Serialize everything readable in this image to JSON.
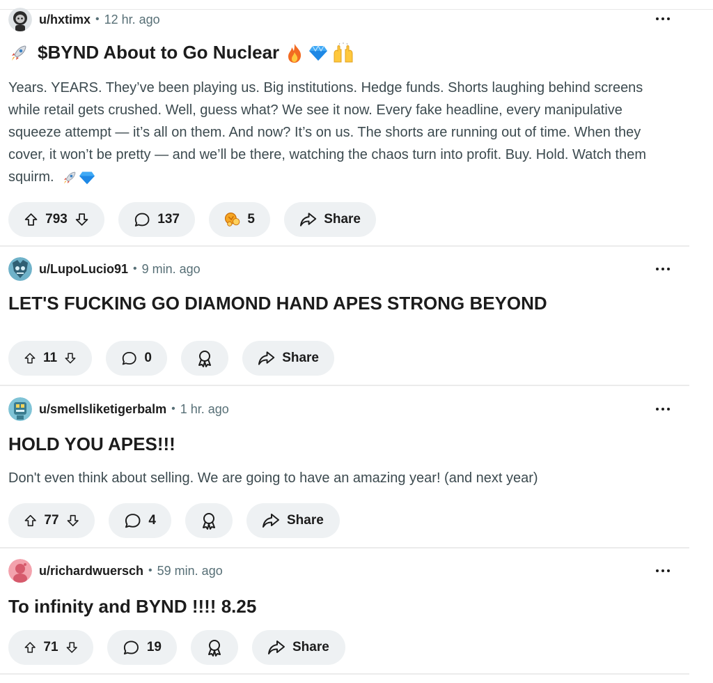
{
  "posts": [
    {
      "username": "u/hxtimx",
      "time": "12 hr. ago",
      "title": "$BYND About to Go Nuclear",
      "body": "Years. YEARS. They’ve been playing us. Big institutions. Hedge funds. Shorts laughing behind screens while retail gets crushed. Well, guess what? We see it now. Every fake headline, every manipulative squeeze attempt — it’s all on them. And now? It’s on us. The shorts are running out of time. When they cover, it won’t be pretty — and we’ll be there, watching the chaos turn into profit. Buy. Hold. Watch them squirm.",
      "votes": "793",
      "comments": "137",
      "awards": "5",
      "share_label": "Share"
    },
    {
      "username": "u/LupoLucio91",
      "time": "9 min. ago",
      "title": "LET'S FUCKING GO DIAMOND HAND APES STRONG BEYOND",
      "votes": "11",
      "comments": "0",
      "share_label": "Share"
    },
    {
      "username": "u/smellsliketigerbalm",
      "time": "1 hr. ago",
      "title": "HOLD YOU APES!!!",
      "body": "Don't even think about selling. We are going to have an amazing year! (and next year)",
      "votes": "77",
      "comments": "4",
      "share_label": "Share"
    },
    {
      "username": "u/richardwuersch",
      "time": "59 min. ago",
      "title": "To infinity and BYND !!!! 8.25",
      "votes": "71",
      "comments": "19",
      "share_label": "Share"
    }
  ],
  "separator": "•",
  "icons": {
    "more": "more-options-icon",
    "upvote": "upvote-arrow-icon",
    "downvote": "downvote-arrow-icon",
    "comment": "comment-bubble-icon",
    "award": "award-icon",
    "share": "share-arrow-icon"
  },
  "colors": {
    "pill_bg": "#eef1f3",
    "meta_text": "#576f76",
    "body_text": "#3c4a4f"
  }
}
